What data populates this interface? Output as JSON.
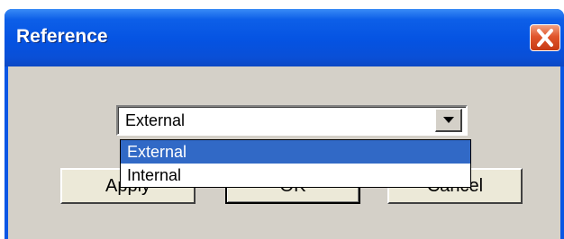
{
  "window": {
    "title": "Reference",
    "close_icon": "close-icon"
  },
  "combo": {
    "selected_value": "External",
    "arrow_icon": "chevron-down-icon"
  },
  "dropdown": {
    "options": [
      "External",
      "Internal"
    ],
    "highlighted_index": 0
  },
  "buttons": {
    "apply": "Apply",
    "ok": "OK",
    "cancel": "Cancel"
  },
  "colors": {
    "titlebar": "#0553e2",
    "client": "#d4d0c8",
    "highlight": "#3169c6",
    "close_button": "#e0552b"
  }
}
